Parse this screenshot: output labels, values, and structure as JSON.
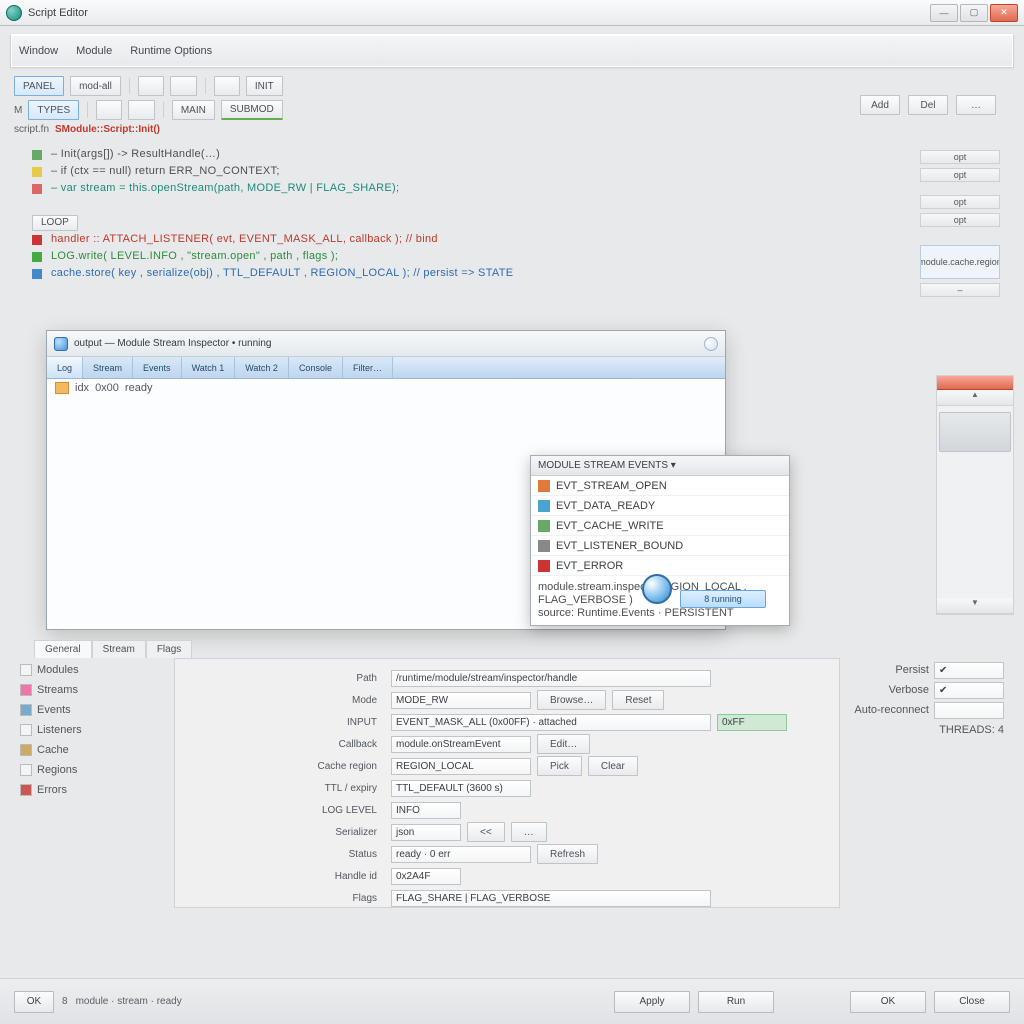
{
  "window": {
    "title": "Script Editor"
  },
  "menubar": {
    "items": [
      "Window",
      "Module",
      "Runtime Options"
    ]
  },
  "hdrbtns": [
    "Add",
    "Del",
    "…"
  ],
  "toolrows": {
    "r1": [
      "PANEL",
      "mod-all",
      "",
      "",
      "",
      "",
      "INIT"
    ],
    "r2": [
      "M",
      "TYPES",
      "",
      "",
      "",
      "MAIN",
      "SUBMOD"
    ],
    "r3_label": "script.fn",
    "r3_value": "SModule::Script::Init()"
  },
  "code": [
    {
      "c": "blk",
      "t": "–  Init(args[])  ->  ResultHandle(…)"
    },
    {
      "c": "",
      "t": "–  if (ctx == null)  return  ERR_NO_CONTEXT;"
    },
    {
      "c": "teal",
      "t": "–  var stream  =  this.openStream(path, MODE_RW | FLAG_SHARE);"
    },
    {
      "c": "",
      "t": ""
    },
    {
      "c": "",
      "t": "LOOP"
    },
    {
      "c": "red",
      "t": "  handler  ::  ATTACH_LISTENER( evt, EVENT_MASK_ALL, callback );  // bind"
    },
    {
      "c": "grn",
      "t": "  LOG.write( LEVEL.INFO , \"stream.open\" , path , flags );"
    },
    {
      "c": "blu",
      "t": "  cache.store( key , serialize(obj) , TTL_DEFAULT , REGION_LOCAL );  // persist => STATE"
    }
  ],
  "rpanels": {
    "p1": [
      "opt",
      "opt"
    ],
    "p2": [
      "opt",
      "opt"
    ],
    "box": "module.cache.region"
  },
  "child": {
    "title": "output — Module Stream Inspector • running",
    "tabs": [
      "Log",
      "Stream",
      "Events",
      "Watch 1",
      "Watch 2",
      "Console",
      "Filter…"
    ],
    "strip": [
      "idx",
      "0x00",
      "ready"
    ]
  },
  "popup": {
    "hdr": "MODULE STREAM EVENTS ▾",
    "items": [
      "EVT_STREAM_OPEN",
      "EVT_DATA_READY",
      "EVT_CACHE_WRITE",
      "EVT_LISTENER_BOUND",
      "EVT_ERROR"
    ],
    "ftr1": "module.stream.inspect( REGION_LOCAL , FLAG_VERBOSE )",
    "ftr2": "source: Runtime.Events  ·  PERSISTENT"
  },
  "taskchip": "8 running",
  "form": {
    "tabs": [
      "General",
      "Stream",
      "Flags"
    ],
    "left": [
      "Modules",
      "Streams",
      "Events",
      "Listeners",
      "Cache",
      "Regions",
      "Errors"
    ],
    "rows": [
      {
        "k": "Path",
        "v": "/runtime/module/stream/inspector/handle"
      },
      {
        "k": "Mode",
        "v": "MODE_RW",
        "b1": "Browse…",
        "b2": "Reset"
      },
      {
        "k": "INPUT",
        "v": "EVENT_MASK_ALL  (0x00FF)  · attached",
        "chip": "0xFF"
      },
      {
        "k": "Callback",
        "v": "module.onStreamEvent",
        "b1": "Edit…"
      },
      {
        "k": "Cache region",
        "v": "REGION_LOCAL",
        "b1": "Pick",
        "b2": "Clear"
      },
      {
        "k": "TTL / expiry",
        "v": "TTL_DEFAULT  (3600 s)"
      },
      {
        "k": "LOG LEVEL",
        "v": "INFO"
      },
      {
        "k": "Serializer",
        "v": "json",
        "b1": "<<",
        "b2": "…"
      },
      {
        "k": "Status",
        "v": "ready · 0 err",
        "b1": "Refresh"
      },
      {
        "k": "Handle id",
        "v": "0x2A4F"
      },
      {
        "k": "Flags",
        "v": "FLAG_SHARE | FLAG_VERBOSE"
      }
    ],
    "right": [
      "Persist",
      "Verbose",
      "Auto-reconnect",
      "THREADS: 4"
    ]
  },
  "footer": {
    "left": [
      "OK",
      "8"
    ],
    "status": "module · stream · ready",
    "btns": [
      "Apply",
      "Run",
      "OK",
      "Close"
    ]
  }
}
